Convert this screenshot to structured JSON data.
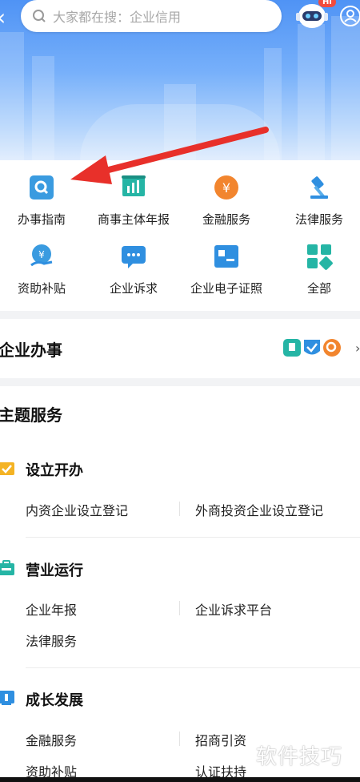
{
  "header": {
    "search_placeholder": "大家都在搜：企业信用",
    "robot_badge": "Hi"
  },
  "quick_services": [
    {
      "label": "办事指南",
      "icon": "search-guide-icon",
      "color": "#3a9be0"
    },
    {
      "label": "商事主体年报",
      "icon": "report-board-icon",
      "color": "#25b5a5"
    },
    {
      "label": "金融服务",
      "icon": "yuan-coin-icon",
      "color": "#f2852e"
    },
    {
      "label": "法律服务",
      "icon": "gavel-icon",
      "color": "#2f8fe0"
    },
    {
      "label": "资助补贴",
      "icon": "subsidy-hand-icon",
      "color": "#3a9be0"
    },
    {
      "label": "企业诉求",
      "icon": "chat-bubble-icon",
      "color": "#2f8fe0"
    },
    {
      "label": "企业电子证照",
      "icon": "license-card-icon",
      "color": "#2f8fe0"
    },
    {
      "label": "全部",
      "icon": "all-grid-icon",
      "color": "#25b5a5"
    }
  ],
  "enterprise_affairs": {
    "title": "企业办事"
  },
  "theme_services": {
    "title": "主题服务",
    "categories": [
      {
        "title": "设立开办",
        "icon": "folder-check-icon",
        "items": [
          "内资企业设立登记",
          "外商投资企业设立登记"
        ]
      },
      {
        "title": "营业运行",
        "icon": "briefcase-icon",
        "items": [
          "企业年报",
          "企业诉求平台",
          "法律服务"
        ]
      },
      {
        "title": "成长发展",
        "icon": "growth-chart-icon",
        "items": [
          "金融服务",
          "招商引资",
          "资助补贴",
          "认证扶持"
        ]
      }
    ]
  },
  "watermark": "软件技巧",
  "colors": {
    "accent": "#2f8fe0",
    "annotation_arrow": "#e8302a"
  }
}
